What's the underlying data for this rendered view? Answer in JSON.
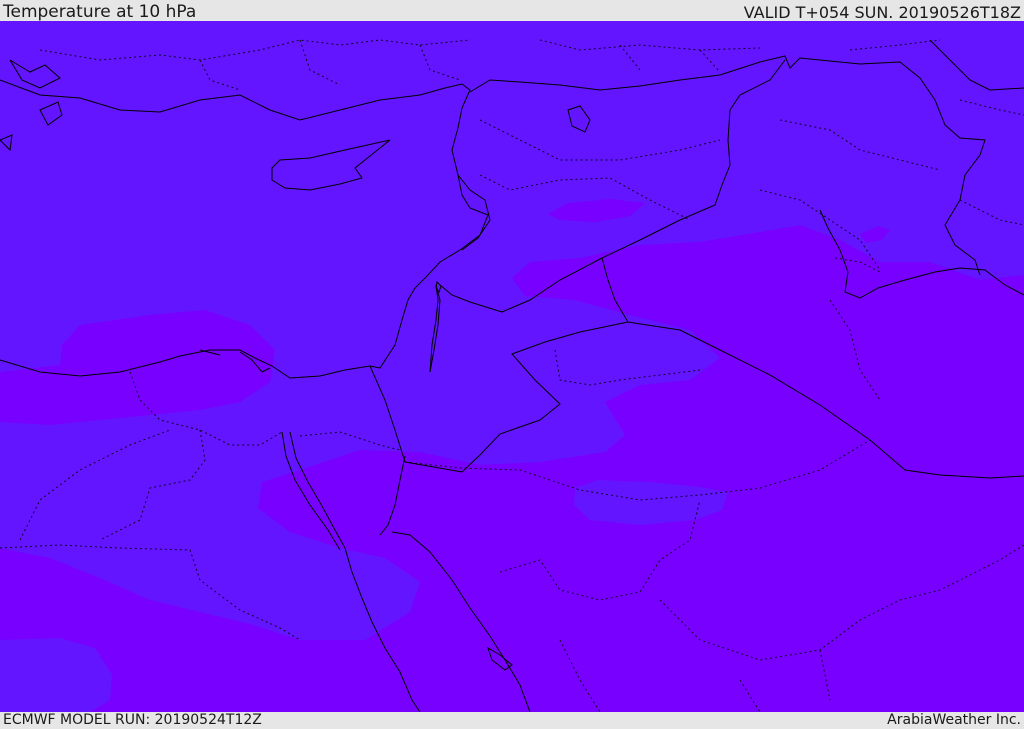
{
  "header": {
    "title": "Temperature at 10 hPa",
    "valid": "VALID T+054 SUN. 20190526T18Z"
  },
  "footer": {
    "model_run": "ECMWF MODEL RUN: 20190524T12Z",
    "credit": "ArabiaWeather Inc."
  },
  "colors": {
    "warmer_band": "#6415ff",
    "cooler_band": "#7800ff",
    "coastline": "#000000",
    "border": "#000000",
    "header_bg": "#e6e6e6"
  }
}
